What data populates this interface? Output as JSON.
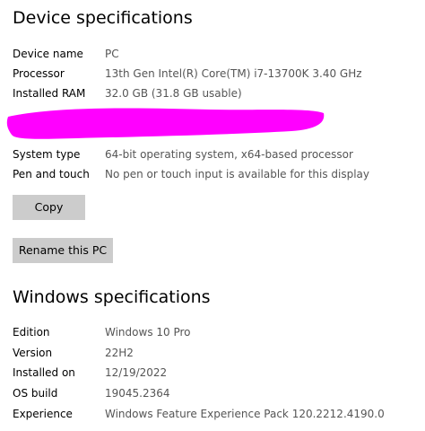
{
  "device_specs": {
    "title": "Device specifications",
    "rows": [
      {
        "label": "Device name",
        "value": "PC"
      },
      {
        "label": "Processor",
        "value": "13th Gen Intel(R) Core(TM) i7-13700K   3.40 GHz"
      },
      {
        "label": "Installed RAM",
        "value": "32.0 GB (31.8 GB usable)"
      },
      {
        "label": "System type",
        "value": "64-bit operating system, x64-based processor"
      },
      {
        "label": "Pen and touch",
        "value": "No pen or touch input is available for this display"
      }
    ],
    "redaction_color": "#ff00ff"
  },
  "buttons": {
    "copy": "Copy",
    "rename": "Rename this PC"
  },
  "windows_specs": {
    "title": "Windows specifications",
    "rows": [
      {
        "label": "Edition",
        "value": "Windows 10 Pro"
      },
      {
        "label": "Version",
        "value": "22H2"
      },
      {
        "label": "Installed on",
        "value": "12/19/2022"
      },
      {
        "label": "OS build",
        "value": "19045.2364"
      },
      {
        "label": "Experience",
        "value": "Windows Feature Experience Pack 120.2212.4190.0"
      }
    ]
  }
}
